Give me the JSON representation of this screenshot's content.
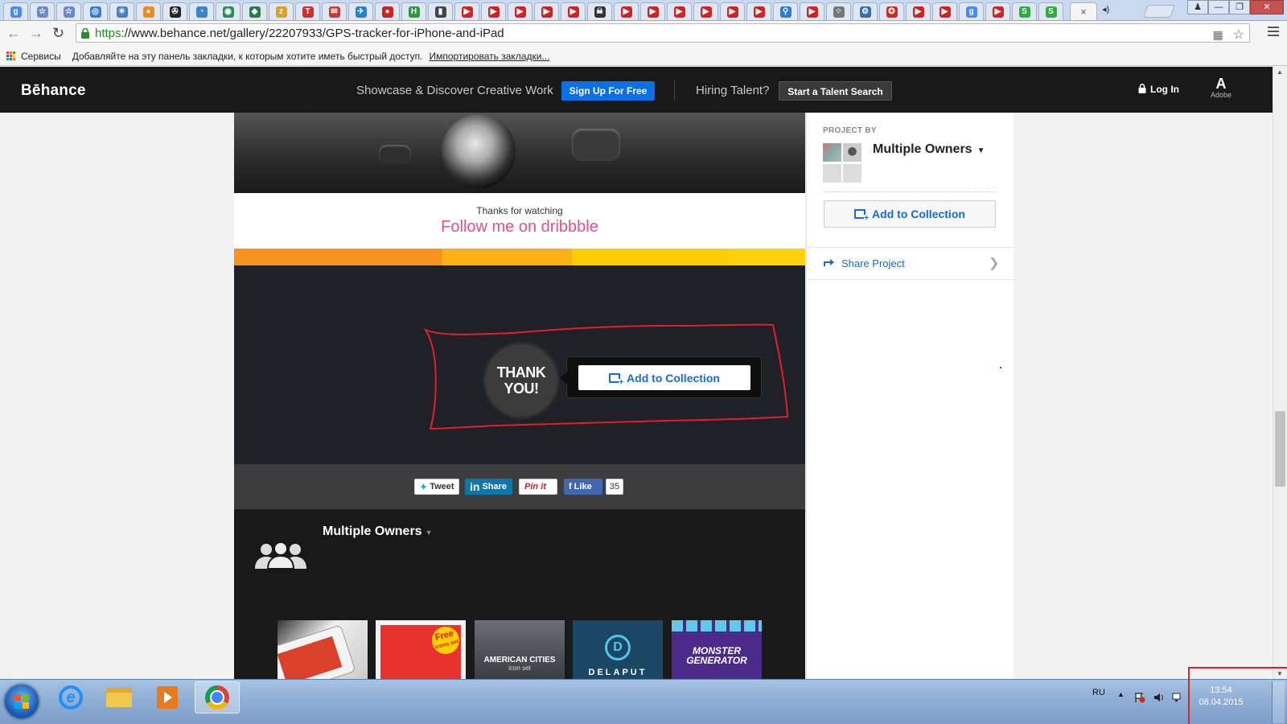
{
  "browser": {
    "tabs": [
      {
        "icon": "google-icon",
        "color": "#4a8af4",
        "glyph": "g"
      },
      {
        "icon": "star-icon",
        "color": "#6b8ac9",
        "glyph": "☆"
      },
      {
        "icon": "star-icon",
        "color": "#6b8ac9",
        "glyph": "☆"
      },
      {
        "icon": "globe-icon",
        "color": "#3d7bd1",
        "glyph": "◎"
      },
      {
        "icon": "network-icon",
        "color": "#4a7fc4",
        "glyph": "✳"
      },
      {
        "icon": "paw-icon",
        "color": "#f08a1c",
        "glyph": "●"
      },
      {
        "icon": "film-icon",
        "color": "#222222",
        "glyph": "✇"
      },
      {
        "icon": "hc-icon",
        "color": "#3b84c5",
        "glyph": "◔"
      },
      {
        "icon": "eye-icon",
        "color": "#2d8f58",
        "glyph": "◉"
      },
      {
        "icon": "drop-icon",
        "color": "#2a7a4a",
        "glyph": "◆"
      },
      {
        "icon": "z-icon",
        "color": "#d7a12a",
        "glyph": "z"
      },
      {
        "icon": "t-icon",
        "color": "#d62b2b",
        "glyph": "T"
      },
      {
        "icon": "mail-icon",
        "color": "#cf3838",
        "glyph": "✉"
      },
      {
        "icon": "bird-icon",
        "color": "#2a7fd0",
        "glyph": "✈"
      },
      {
        "icon": "pro-icon",
        "color": "#c22",
        "glyph": "●"
      },
      {
        "icon": "h-icon",
        "color": "#2d9a3a",
        "glyph": "H"
      },
      {
        "icon": "chart-icon",
        "color": "#444444",
        "glyph": "▮"
      },
      {
        "icon": "youtube-icon",
        "color": "#d12323",
        "glyph": "▶"
      },
      {
        "icon": "youtube-icon",
        "color": "#d12323",
        "glyph": "▶"
      },
      {
        "icon": "youtube-icon",
        "color": "#d12323",
        "glyph": "▶"
      },
      {
        "icon": "youtube-icon",
        "color": "#d12323",
        "glyph": "▶"
      },
      {
        "icon": "youtube-icon",
        "color": "#d12323",
        "glyph": "▶"
      },
      {
        "icon": "skull-icon",
        "color": "#333333",
        "glyph": "☠"
      },
      {
        "icon": "youtube-icon",
        "color": "#d12323",
        "glyph": "▶"
      },
      {
        "icon": "youtube-icon",
        "color": "#d12323",
        "glyph": "▶"
      },
      {
        "icon": "youtube-icon",
        "color": "#d12323",
        "glyph": "▶"
      },
      {
        "icon": "youtube-icon",
        "color": "#d12323",
        "glyph": "▶"
      },
      {
        "icon": "youtube-icon",
        "color": "#d12323",
        "glyph": "▶"
      },
      {
        "icon": "youtube-icon",
        "color": "#d12323",
        "glyph": "▶"
      },
      {
        "icon": "pin-icon",
        "color": "#2f7ad4",
        "glyph": "⚲"
      },
      {
        "icon": "youtube-icon",
        "color": "#d12323",
        "glyph": "▶"
      },
      {
        "icon": "dots-icon",
        "color": "#777777",
        "glyph": "⁘"
      },
      {
        "icon": "gear-icon",
        "color": "#3a6ea8",
        "glyph": "⚙"
      },
      {
        "icon": "emblem-icon",
        "color": "#d4281c",
        "glyph": "✪"
      },
      {
        "icon": "youtube-icon",
        "color": "#d12323",
        "glyph": "▶"
      },
      {
        "icon": "youtube-icon",
        "color": "#d12323",
        "glyph": "▶"
      },
      {
        "icon": "google-icon",
        "color": "#4a8af4",
        "glyph": "g"
      },
      {
        "icon": "youtube-icon",
        "color": "#d12323",
        "glyph": "▶"
      },
      {
        "icon": "s-icon",
        "color": "#2fae3f",
        "glyph": "S"
      },
      {
        "icon": "s-icon",
        "color": "#2fae3f",
        "glyph": "S"
      }
    ],
    "active_tab_close": "×",
    "audio_glyph": "◂)",
    "url_scheme": "https",
    "url_rest": "://www.behance.net/gallery/22207933/GPS-tracker-for-iPhone-and-iPad",
    "bookmarks": {
      "apps_label": "Сервисы",
      "hint": "Добавляйте на эту панель закладки, к которым хотите иметь быстрый доступ.",
      "import_link": "Импортировать закладки..."
    }
  },
  "header": {
    "logo": "Bēhance",
    "tagline": "Showcase & Discover Creative Work",
    "signup": "Sign Up For Free",
    "hiring": "Hiring Talent?",
    "talent_search": "Start a Talent Search",
    "login": "Log In",
    "adobe_mark": "A",
    "adobe_label": "Adobe"
  },
  "main": {
    "thanks_small": "Thanks for watching",
    "follow_link": "Follow me on dribbble",
    "color_bar": [
      "#f7941d",
      "#fbb116",
      "#ffcb05",
      "#ffd10a"
    ],
    "badge_line1": "THANK",
    "badge_line2": "YOU!",
    "add_to_collection": "Add to Collection",
    "share": {
      "tweet": "Tweet",
      "linkedin": "Share",
      "pinterest": "Pin it",
      "facebook": "Like",
      "facebook_count": "35"
    },
    "owners_name": "Multiple Owners",
    "thumbs": {
      "t2_badge_line1": "Free",
      "t2_badge_line2": "icons set",
      "t3_title": "AMERICAN CITIES",
      "t3_sub": "icon set",
      "t4_letter": "D",
      "t4_label": "DELAPUT",
      "t5_line1": "MONSTER",
      "t5_line2": "GENERATOR"
    }
  },
  "sidebar": {
    "project_by": "PROJECT BY",
    "owners": "Multiple Owners",
    "add_to_collection": "Add to Collection",
    "share_project": "Share Project"
  },
  "taskbar": {
    "lang": "RU",
    "time": "13:54",
    "date": "08.04.2015"
  },
  "colors": {
    "behance_blue": "#0b6fe5",
    "link_blue": "#1769d9",
    "dribbble_pink": "#ea4c89",
    "annotation_red": "#e0202a"
  }
}
